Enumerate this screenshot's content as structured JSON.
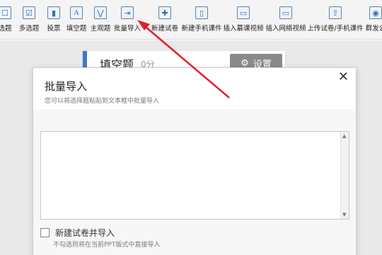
{
  "toolbar": {
    "items_left": [
      {
        "icon": "single-choice-icon",
        "glyph": "☐",
        "label": "选题"
      },
      {
        "icon": "multi-choice-icon",
        "glyph": "☑",
        "label": "多选题"
      },
      {
        "icon": "vote-icon",
        "glyph": "▮",
        "label": "投票"
      },
      {
        "icon": "fill-blank-icon",
        "glyph": "A",
        "label": "填空题"
      },
      {
        "icon": "subjective-icon",
        "glyph": "⋁",
        "label": "主观题"
      },
      {
        "icon": "batch-import-icon",
        "glyph": "⇥",
        "label": "批量导入"
      }
    ],
    "items_right": [
      {
        "icon": "new-quiz-icon",
        "glyph": "✚",
        "label": "新建试卷"
      },
      {
        "icon": "new-mobile-courseware-icon",
        "glyph": "▯",
        "label": "新建手机课件"
      },
      {
        "icon": "insert-mooc-video-icon",
        "glyph": "▭",
        "label": "插入慕课视频"
      },
      {
        "icon": "insert-web-video-icon",
        "glyph": "▭",
        "label": "插入网络视频"
      },
      {
        "icon": "upload-icon",
        "glyph": "⇧",
        "label": "上传试卷/手机课件"
      },
      {
        "icon": "group-send-icon",
        "glyph": "◉",
        "label": "群发公"
      }
    ]
  },
  "question_card": {
    "title": "填空题",
    "score": "0分",
    "settings_label": "设置"
  },
  "dialog": {
    "title": "批量导入",
    "subtitle": "您可以将选择题粘贴到文本框中批量导入",
    "textarea_value": "",
    "checkbox_label": "新建试卷并导入",
    "checkbox_checked": false,
    "hint": "不勾选则将在当前PPT版式中直接导入"
  },
  "colors": {
    "accent": "#3f79c8",
    "arrow": "#e0212a",
    "settings_bg": "#8a8a8a"
  }
}
